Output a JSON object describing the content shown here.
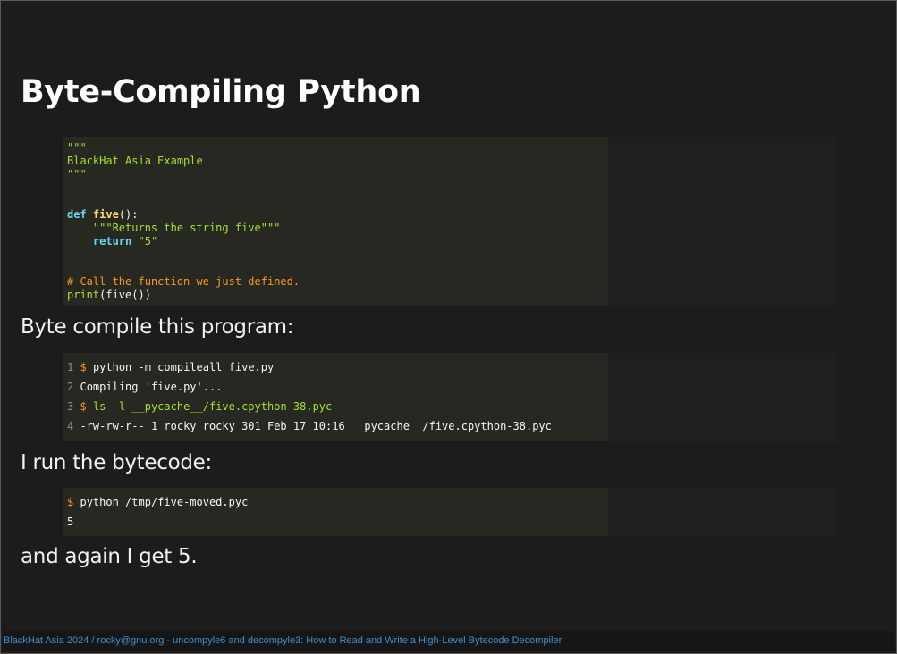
{
  "slide": {
    "title": "Byte-Compiling Python",
    "para1": "Byte compile this program:",
    "para2": "I run the bytecode:",
    "para3": "and again I get 5."
  },
  "code_block_1": {
    "language": "python",
    "lines": [
      "\"\"\"",
      "BlackHat Asia Example",
      "\"\"\"",
      "",
      "",
      "def five():",
      "    \"\"\"Returns the string five\"\"\"",
      "    return \"5\"",
      "",
      "",
      "# Call the function we just defined.",
      "print(five())"
    ]
  },
  "code_block_2": {
    "language": "console",
    "line_numbers": [
      "1",
      "2",
      "3",
      "4"
    ],
    "lines": [
      {
        "prompt": "$",
        "text": "python -m compileall five.py"
      },
      {
        "prompt": "",
        "text": "Compiling 'five.py'..."
      },
      {
        "prompt": "$",
        "text": "ls -l __pycache__/five.cpython-38.pyc"
      },
      {
        "prompt": "",
        "text": "-rw-rw-r-- 1 rocky rocky 301 Feb 17 10:16 __pycache__/five.cpython-38.pyc"
      }
    ]
  },
  "code_block_3": {
    "language": "console",
    "lines": [
      {
        "prompt": "$",
        "text": "python /tmp/five-moved.pyc"
      },
      {
        "prompt": "",
        "text": "5"
      }
    ]
  },
  "footer": {
    "text": "BlackHat Asia 2024 / rocky@gnu.org - uncompyle6 and decompyle3: How to Read and Write a High-Level Bytecode Decompiler"
  },
  "colors": {
    "background": "#1c1c1c",
    "code_background": "#272822",
    "footer_link": "#3d8fd1",
    "keyword": "#66d9ef",
    "string": "#a6e22e",
    "comment": "#fd971f"
  }
}
